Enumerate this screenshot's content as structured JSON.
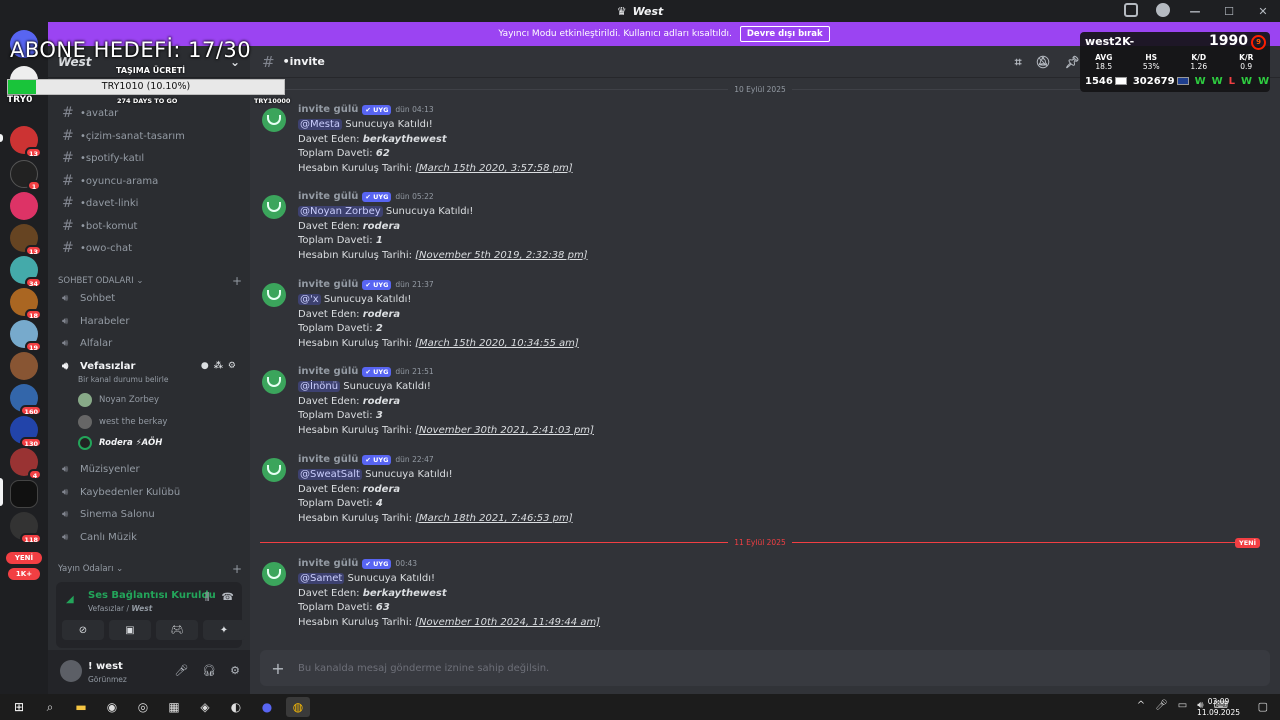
{
  "window": {
    "title": "West"
  },
  "banner": {
    "text": "Yayıncı Modu etkinleştirildi. Kullanıcı adları kısaltıldı.",
    "button": "Devre dışı bırak"
  },
  "overlay": {
    "goal": "ABONE HEDEFİ: 17/30",
    "fee_title": "TAŞIMA ÜCRETİ",
    "progress_text": "TRY1010 (10.10%)",
    "progress_fraction": 0.101,
    "days": "274 DAYS TO GO",
    "min": "TRY0",
    "max": "TRY10000"
  },
  "faceit": {
    "user": "west2K-",
    "elo": "1990",
    "level": "9",
    "stats": [
      {
        "k": "AVG",
        "v": "18.5"
      },
      {
        "k": "HS",
        "v": "53%"
      },
      {
        "k": "K/D",
        "v": "1.26"
      },
      {
        "k": "K/R",
        "v": "0.9"
      }
    ],
    "rank_left": "1546",
    "rank_right": "302679",
    "results": [
      "W",
      "W",
      "L",
      "W",
      "W"
    ]
  },
  "rail_badges": [
    "13",
    "1",
    "13",
    "34",
    "18",
    "19",
    "160",
    "130",
    "4",
    "118",
    "1K+"
  ],
  "rail_new": "YENİ",
  "server": {
    "name": "West"
  },
  "channels": [
    {
      "name": "•avatar"
    },
    {
      "name": "•çizim-sanat-tasarım"
    },
    {
      "name": "•spotify-katıl"
    },
    {
      "name": "•oyuncu-arama"
    },
    {
      "name": "•davet-linki"
    },
    {
      "name": "•bot-komut"
    },
    {
      "name": "•owo-chat"
    }
  ],
  "voice_category": "SOHBET ODALARI",
  "voice_channels": [
    "Sohbet",
    "Harabeler",
    "Alfalar"
  ],
  "active_voice": {
    "name": "Vefasızlar",
    "status": "Bir kanal durumu belirle"
  },
  "voice_users": [
    "Noyan Zorbey",
    "west the berkay",
    "Rodera ⚡AÖH"
  ],
  "voice_channels_2": [
    "Müzisyenler",
    "Kaybedenler Kulübü",
    "Sinema Salonu",
    "Canlı Müzik"
  ],
  "stream_category": "Yayın Odaları",
  "voice_panel": {
    "status": "Ses Bağlantısı Kuruldu",
    "channel": "Vefasızlar",
    "server": "West"
  },
  "user": {
    "name": "! west",
    "status": "Görünmez"
  },
  "main": {
    "channel": "•invite",
    "day1": "10 Eylül 2025",
    "day2": "11 Eylül 2025",
    "new_label": "YENİ",
    "placeholder": "Bu kanalda mesaj gönderme iznine sahip değilsin."
  },
  "labels": {
    "joined": "Sunucuya Katıldı!",
    "invited_by": "Davet Eden:",
    "total": "Toplam Daveti:",
    "created": "Hesabın Kuruluş Tarihi:"
  },
  "messages": [
    {
      "author": "invite gülü",
      "tag": "UYG",
      "time": "dün 04:13",
      "mention": "@Mesta",
      "inviter": "berkaythewest",
      "count": "62",
      "date": "[March 15th 2020, 3:57:58 pm]"
    },
    {
      "author": "invite gülü",
      "tag": "UYG",
      "time": "dün 05:22",
      "mention": "@Noyan Zorbey",
      "inviter": "rodera",
      "count": "1",
      "date": "[November 5th 2019, 2:32:38 pm]"
    },
    {
      "author": "invite gülü",
      "tag": "UYG",
      "time": "dün 21:37",
      "mention": "@'x",
      "inviter": "rodera",
      "count": "2",
      "date": "[March 15th 2020, 10:34:55 am]"
    },
    {
      "author": "invite gülü",
      "tag": "UYG",
      "time": "dün 21:51",
      "mention": "@İnönü",
      "inviter": "rodera",
      "count": "3",
      "date": "[November 30th 2021, 2:41:03 pm]"
    },
    {
      "author": "invite gülü",
      "tag": "UYG",
      "time": "dün 22:47",
      "mention": "@SweatSalt",
      "inviter": "rodera",
      "count": "4",
      "date": "[March 18th 2021, 7:46:53 pm]"
    },
    {
      "author": "invite gülü",
      "tag": "UYG",
      "time": "00:43",
      "mention": "@Samet",
      "inviter": "berkaythewest",
      "count": "63",
      "date": "[November 10th 2024, 11:49:44 am]"
    }
  ],
  "taskbar": {
    "time": "03:09",
    "date": "11.09.2025"
  }
}
